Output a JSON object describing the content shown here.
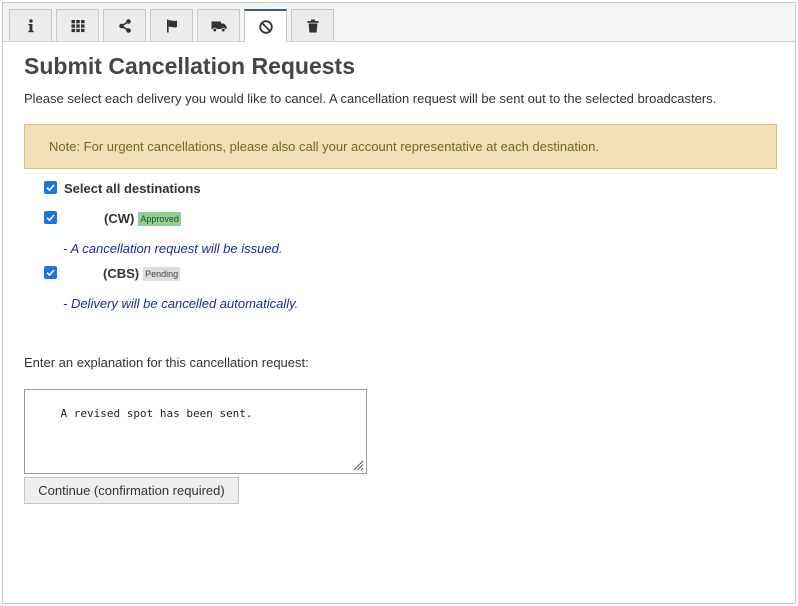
{
  "tabs": [
    {
      "icon": "info-icon"
    },
    {
      "icon": "grid-icon"
    },
    {
      "icon": "share-icon"
    },
    {
      "icon": "flag-icon"
    },
    {
      "icon": "truck-icon"
    },
    {
      "icon": "ban-icon",
      "active": true
    },
    {
      "icon": "trash-icon"
    }
  ],
  "page": {
    "title": "Submit Cancellation Requests",
    "intro": "Please select each delivery you would like to cancel. A cancellation request will be sent out to the selected broadcasters.",
    "note": "Note: For urgent cancellations, please also call your account representative at each destination."
  },
  "select_all": {
    "label": "Select all destinations",
    "checked": true
  },
  "destinations": [
    {
      "label": "(CW)",
      "status": "Approved",
      "checked": true,
      "message": "- A cancellation request will be issued."
    },
    {
      "label": "(CBS)",
      "status": "Pending",
      "checked": true,
      "message": "- Delivery will be cancelled automatically."
    }
  ],
  "explanation": {
    "label": "Enter an explanation for this cancellation request:",
    "value": "A revised spot has been sent."
  },
  "continue_button": "Continue (confirmation required)",
  "colors": {
    "accent": "#1a73e8",
    "note_bg": "#efe0b7",
    "note_text": "#7a6326",
    "approved": "#8fcf8f",
    "pending": "#dedede",
    "message_text": "#1e2a9c"
  }
}
